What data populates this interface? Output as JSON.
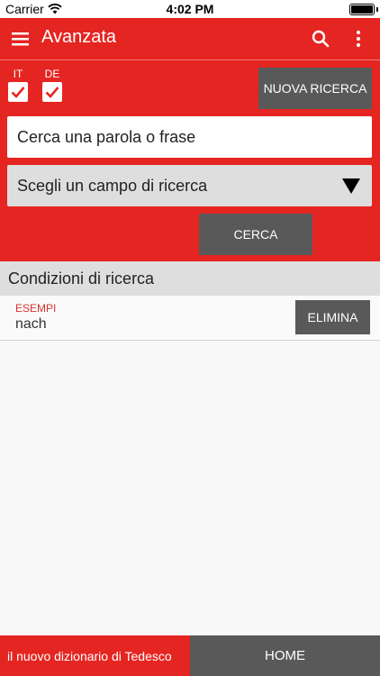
{
  "status_bar": {
    "carrier": "Carrier",
    "time": "4:02 PM",
    "battery_level": 1.0
  },
  "app_bar": {
    "title": "Avanzata",
    "icons": [
      "menu-icon",
      "search-icon",
      "more-vertical-icon"
    ]
  },
  "search": {
    "languages": [
      {
        "label": "IT",
        "checked": true
      },
      {
        "label": "DE",
        "checked": true
      }
    ],
    "new_search_label": "NUOVA RICERCA",
    "query_placeholder": "Cerca una parola o frase",
    "field_select_label": "Scegli un campo di ricerca",
    "submit_label": "CERCA"
  },
  "conditions": {
    "header": "Condizioni di ricerca",
    "items": [
      {
        "type": "ESEMPI",
        "value": "nach",
        "delete_label": "ELIMINA"
      }
    ]
  },
  "bottom_bar": {
    "brand": "il nuovo dizionario di Tedesco",
    "home_label": "HOME"
  },
  "colors": {
    "primary_red": "#e52521",
    "dark_gray": "#595959",
    "light_gray": "#dedede",
    "accent_red_text": "#d6332e"
  }
}
